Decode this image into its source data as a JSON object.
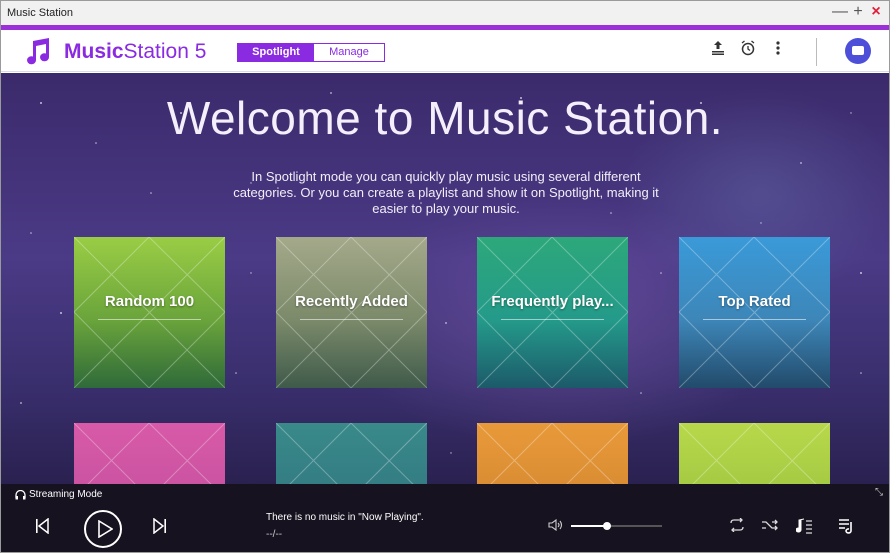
{
  "window": {
    "title": "Music Station",
    "controls": [
      "—",
      "+",
      "×"
    ]
  },
  "header": {
    "brand_bold": "Music",
    "brand_light": "Station 5",
    "tabs": [
      {
        "label": "Spotlight",
        "active": true
      },
      {
        "label": "Manage",
        "active": false
      }
    ],
    "icons": [
      "upload-icon",
      "alarm-icon",
      "more-icon",
      "user-icon"
    ],
    "accent": "#8a2be2"
  },
  "main": {
    "welcome": "Welcome to Music Station.",
    "intro": "In Spotlight mode you can quickly play music using several different categories. Or you can create a playlist and show it on Spotlight, making it easier to play your music.",
    "tiles": [
      {
        "label": "Random 100"
      },
      {
        "label": "Recently Added"
      },
      {
        "label": "Frequently play..."
      },
      {
        "label": "Top Rated"
      },
      {
        "label": ""
      },
      {
        "label": ""
      },
      {
        "label": ""
      },
      {
        "label": ""
      }
    ]
  },
  "player": {
    "mode": "Streaming Mode",
    "now_playing": "There is no music in \"Now Playing\".",
    "time": "--/--",
    "volume": 0.4,
    "controls": [
      "repeat-icon",
      "shuffle-icon",
      "lyrics-icon",
      "queue-icon"
    ]
  }
}
